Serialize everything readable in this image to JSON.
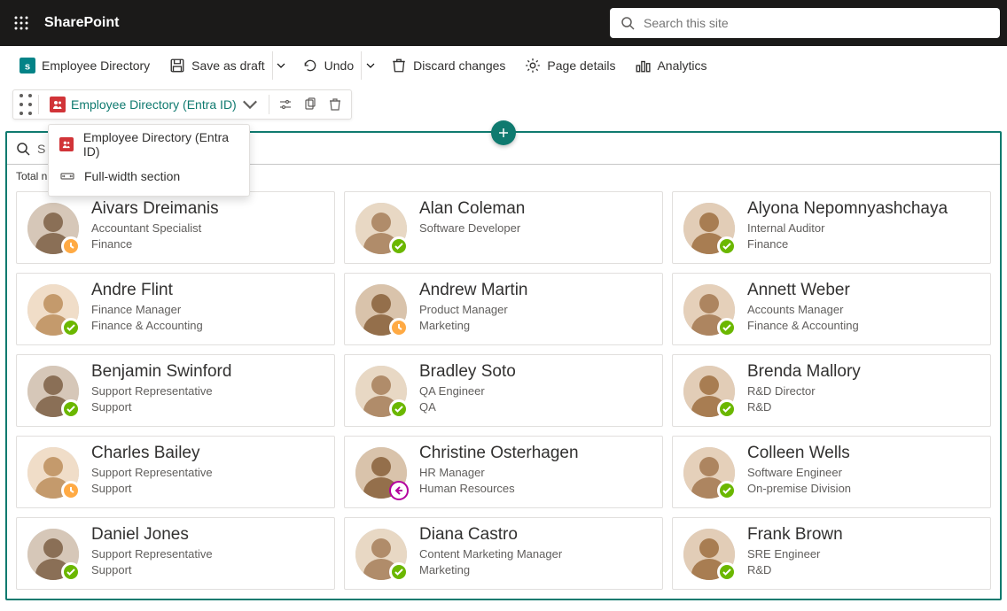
{
  "header": {
    "product": "SharePoint",
    "search_placeholder": "Search this site"
  },
  "commandbar": {
    "site_label": "Employee Directory",
    "save_draft": "Save as draft",
    "undo": "Undo",
    "discard": "Discard changes",
    "page_details": "Page details",
    "analytics": "Analytics"
  },
  "webpart": {
    "selected_label": "Employee Directory (Entra ID)",
    "menu": [
      {
        "label": "Employee Directory (Entra ID)",
        "icon": "app"
      },
      {
        "label": "Full-width section",
        "icon": "fullwidth"
      }
    ]
  },
  "section": {
    "search_hint": "S",
    "total_label": "Total nu"
  },
  "employees": [
    {
      "name": "Aivars Dreimanis",
      "title": "Accountant Specialist",
      "dept": "Finance",
      "presence": "away"
    },
    {
      "name": "Alan Coleman",
      "title": "Software Developer",
      "dept": "",
      "presence": "available"
    },
    {
      "name": "Alyona Nepomnyashchaya",
      "title": "Internal Auditor",
      "dept": "Finance",
      "presence": "available"
    },
    {
      "name": "Andre Flint",
      "title": "Finance Manager",
      "dept": "Finance & Accounting",
      "presence": "available"
    },
    {
      "name": "Andrew Martin",
      "title": "Product Manager",
      "dept": "Marketing",
      "presence": "away"
    },
    {
      "name": "Annett Weber",
      "title": "Accounts Manager",
      "dept": "Finance & Accounting",
      "presence": "available"
    },
    {
      "name": "Benjamin Swinford",
      "title": "Support Representative",
      "dept": "Support",
      "presence": "available"
    },
    {
      "name": "Bradley Soto",
      "title": "QA Engineer",
      "dept": "QA",
      "presence": "available"
    },
    {
      "name": "Brenda Mallory",
      "title": "R&D Director",
      "dept": "R&D",
      "presence": "available"
    },
    {
      "name": "Charles Bailey",
      "title": "Support Representative",
      "dept": "Support",
      "presence": "away"
    },
    {
      "name": "Christine Osterhagen",
      "title": "HR Manager",
      "dept": "Human Resources",
      "presence": "oof"
    },
    {
      "name": "Colleen Wells",
      "title": "Software Engineer",
      "dept": "On-premise Division",
      "presence": "available"
    },
    {
      "name": "Daniel Jones",
      "title": "Support Representative",
      "dept": "Support",
      "presence": "available"
    },
    {
      "name": "Diana Castro",
      "title": "Content Marketing Manager",
      "dept": "Marketing",
      "presence": "available"
    },
    {
      "name": "Frank Brown",
      "title": "SRE Engineer",
      "dept": "R&D",
      "presence": "available"
    }
  ]
}
